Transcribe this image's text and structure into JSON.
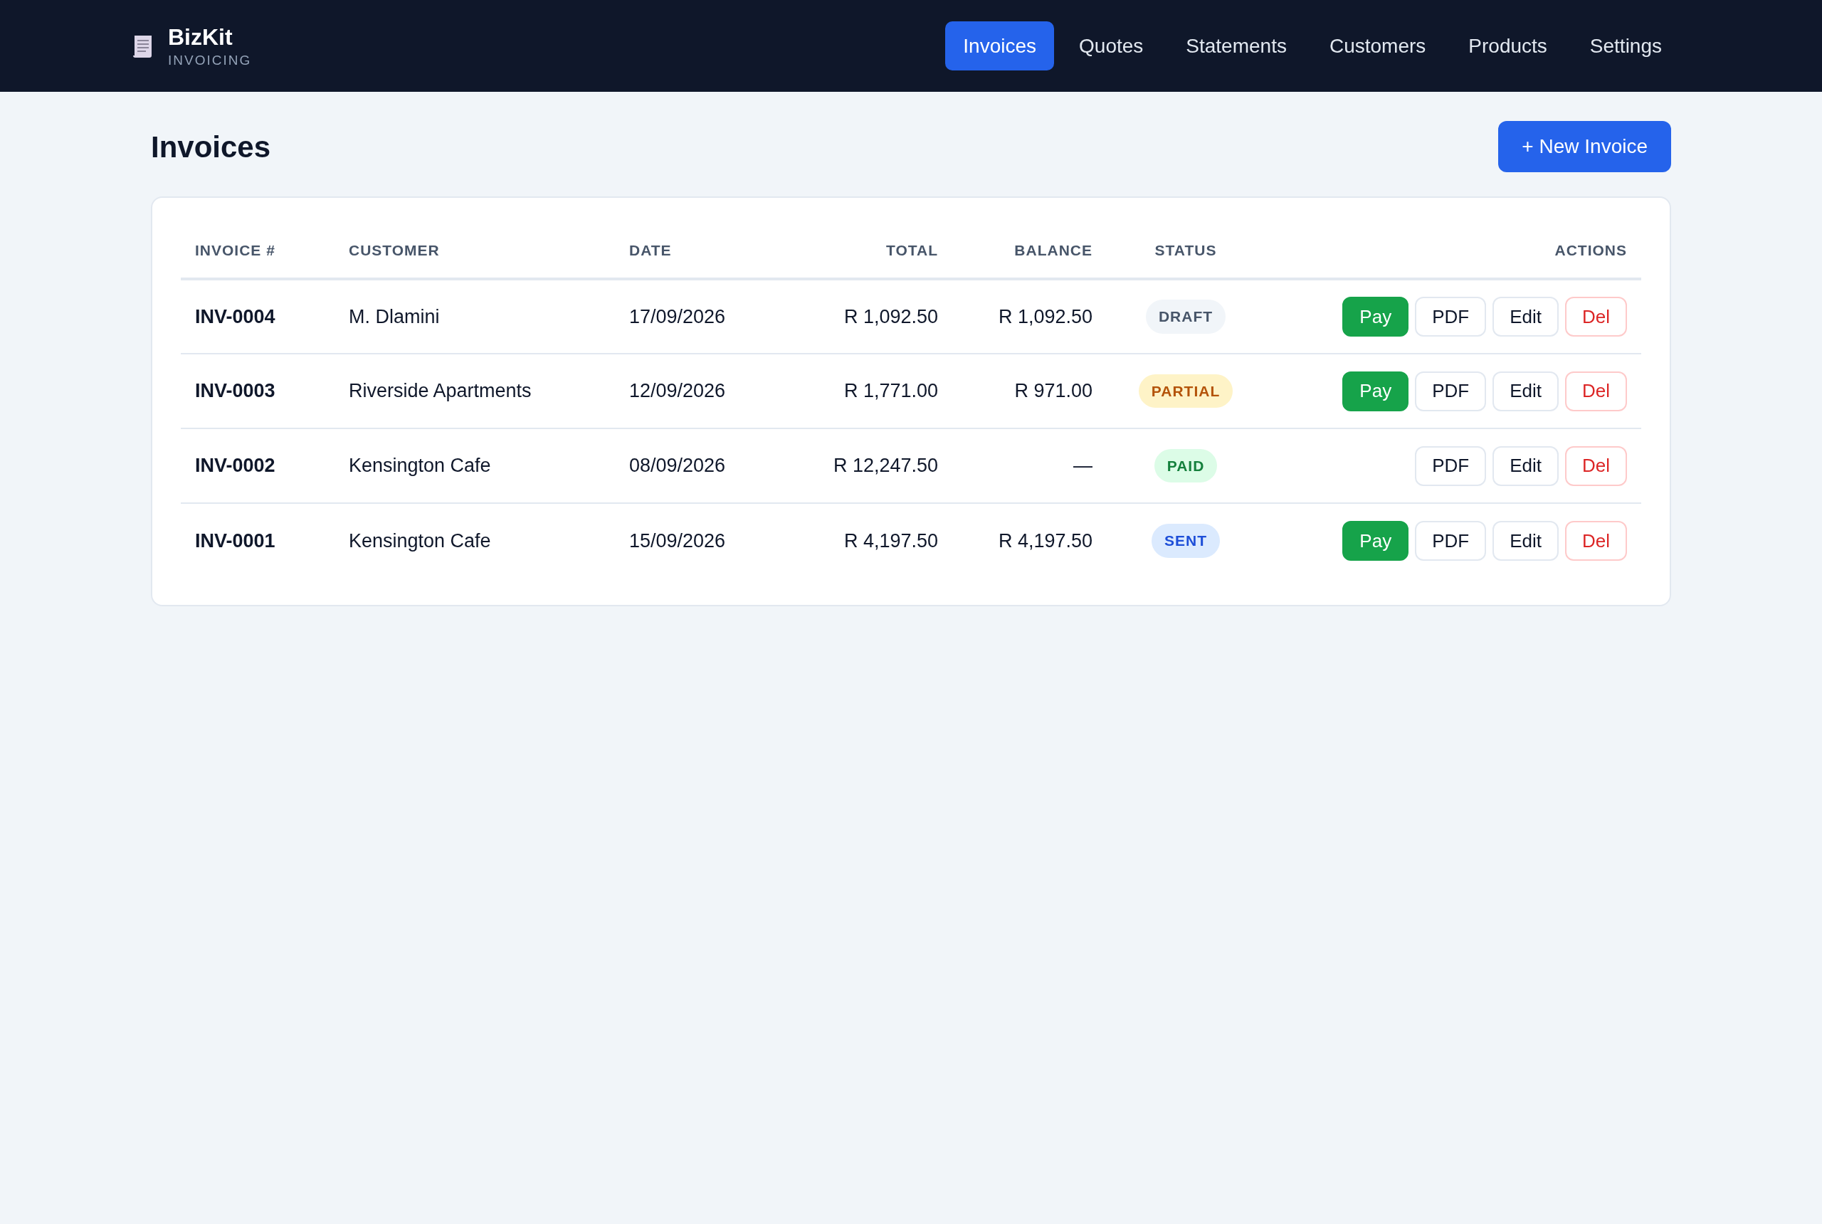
{
  "brand": {
    "name": "BizKit",
    "tagline": "INVOICING"
  },
  "nav": [
    {
      "label": "Invoices",
      "selected": true
    },
    {
      "label": "Quotes",
      "selected": false
    },
    {
      "label": "Statements",
      "selected": false
    },
    {
      "label": "Customers",
      "selected": false
    },
    {
      "label": "Products",
      "selected": false
    },
    {
      "label": "Settings",
      "selected": false
    }
  ],
  "page_title": "Invoices",
  "new_button": "+ New Invoice",
  "table": {
    "columns": [
      "INVOICE #",
      "CUSTOMER",
      "DATE",
      "TOTAL",
      "BALANCE",
      "STATUS",
      "ACTIONS"
    ],
    "rows": [
      {
        "invoice": "INV-0004",
        "customer": "M. Dlamini",
        "date": "17/09/2026",
        "total": "R 1,092.50",
        "balance": "R 1,092.50",
        "status": {
          "label": "DRAFT",
          "kind": "draft"
        },
        "actions": [
          {
            "label": "Pay",
            "kind": "pay"
          },
          {
            "label": "PDF",
            "kind": "plain"
          },
          {
            "label": "Edit",
            "kind": "plain"
          },
          {
            "label": "Del",
            "kind": "danger"
          }
        ]
      },
      {
        "invoice": "INV-0003",
        "customer": "Riverside Apartments",
        "date": "12/09/2026",
        "total": "R 1,771.00",
        "balance": "R 971.00",
        "status": {
          "label": "PARTIAL",
          "kind": "partial"
        },
        "actions": [
          {
            "label": "Pay",
            "kind": "pay"
          },
          {
            "label": "PDF",
            "kind": "plain"
          },
          {
            "label": "Edit",
            "kind": "plain"
          },
          {
            "label": "Del",
            "kind": "danger"
          }
        ]
      },
      {
        "invoice": "INV-0002",
        "customer": "Kensington Cafe",
        "date": "08/09/2026",
        "total": "R 12,247.50",
        "balance": "—",
        "status": {
          "label": "PAID",
          "kind": "paid"
        },
        "actions": [
          {
            "label": "PDF",
            "kind": "plain"
          },
          {
            "label": "Edit",
            "kind": "plain"
          },
          {
            "label": "Del",
            "kind": "danger"
          }
        ]
      },
      {
        "invoice": "INV-0001",
        "customer": "Kensington Cafe",
        "date": "15/09/2026",
        "total": "R 4,197.50",
        "balance": "R 4,197.50",
        "status": {
          "label": "SENT",
          "kind": "sent"
        },
        "actions": [
          {
            "label": "Pay",
            "kind": "pay"
          },
          {
            "label": "PDF",
            "kind": "plain"
          },
          {
            "label": "Edit",
            "kind": "plain"
          },
          {
            "label": "Del",
            "kind": "danger"
          }
        ]
      }
    ]
  }
}
